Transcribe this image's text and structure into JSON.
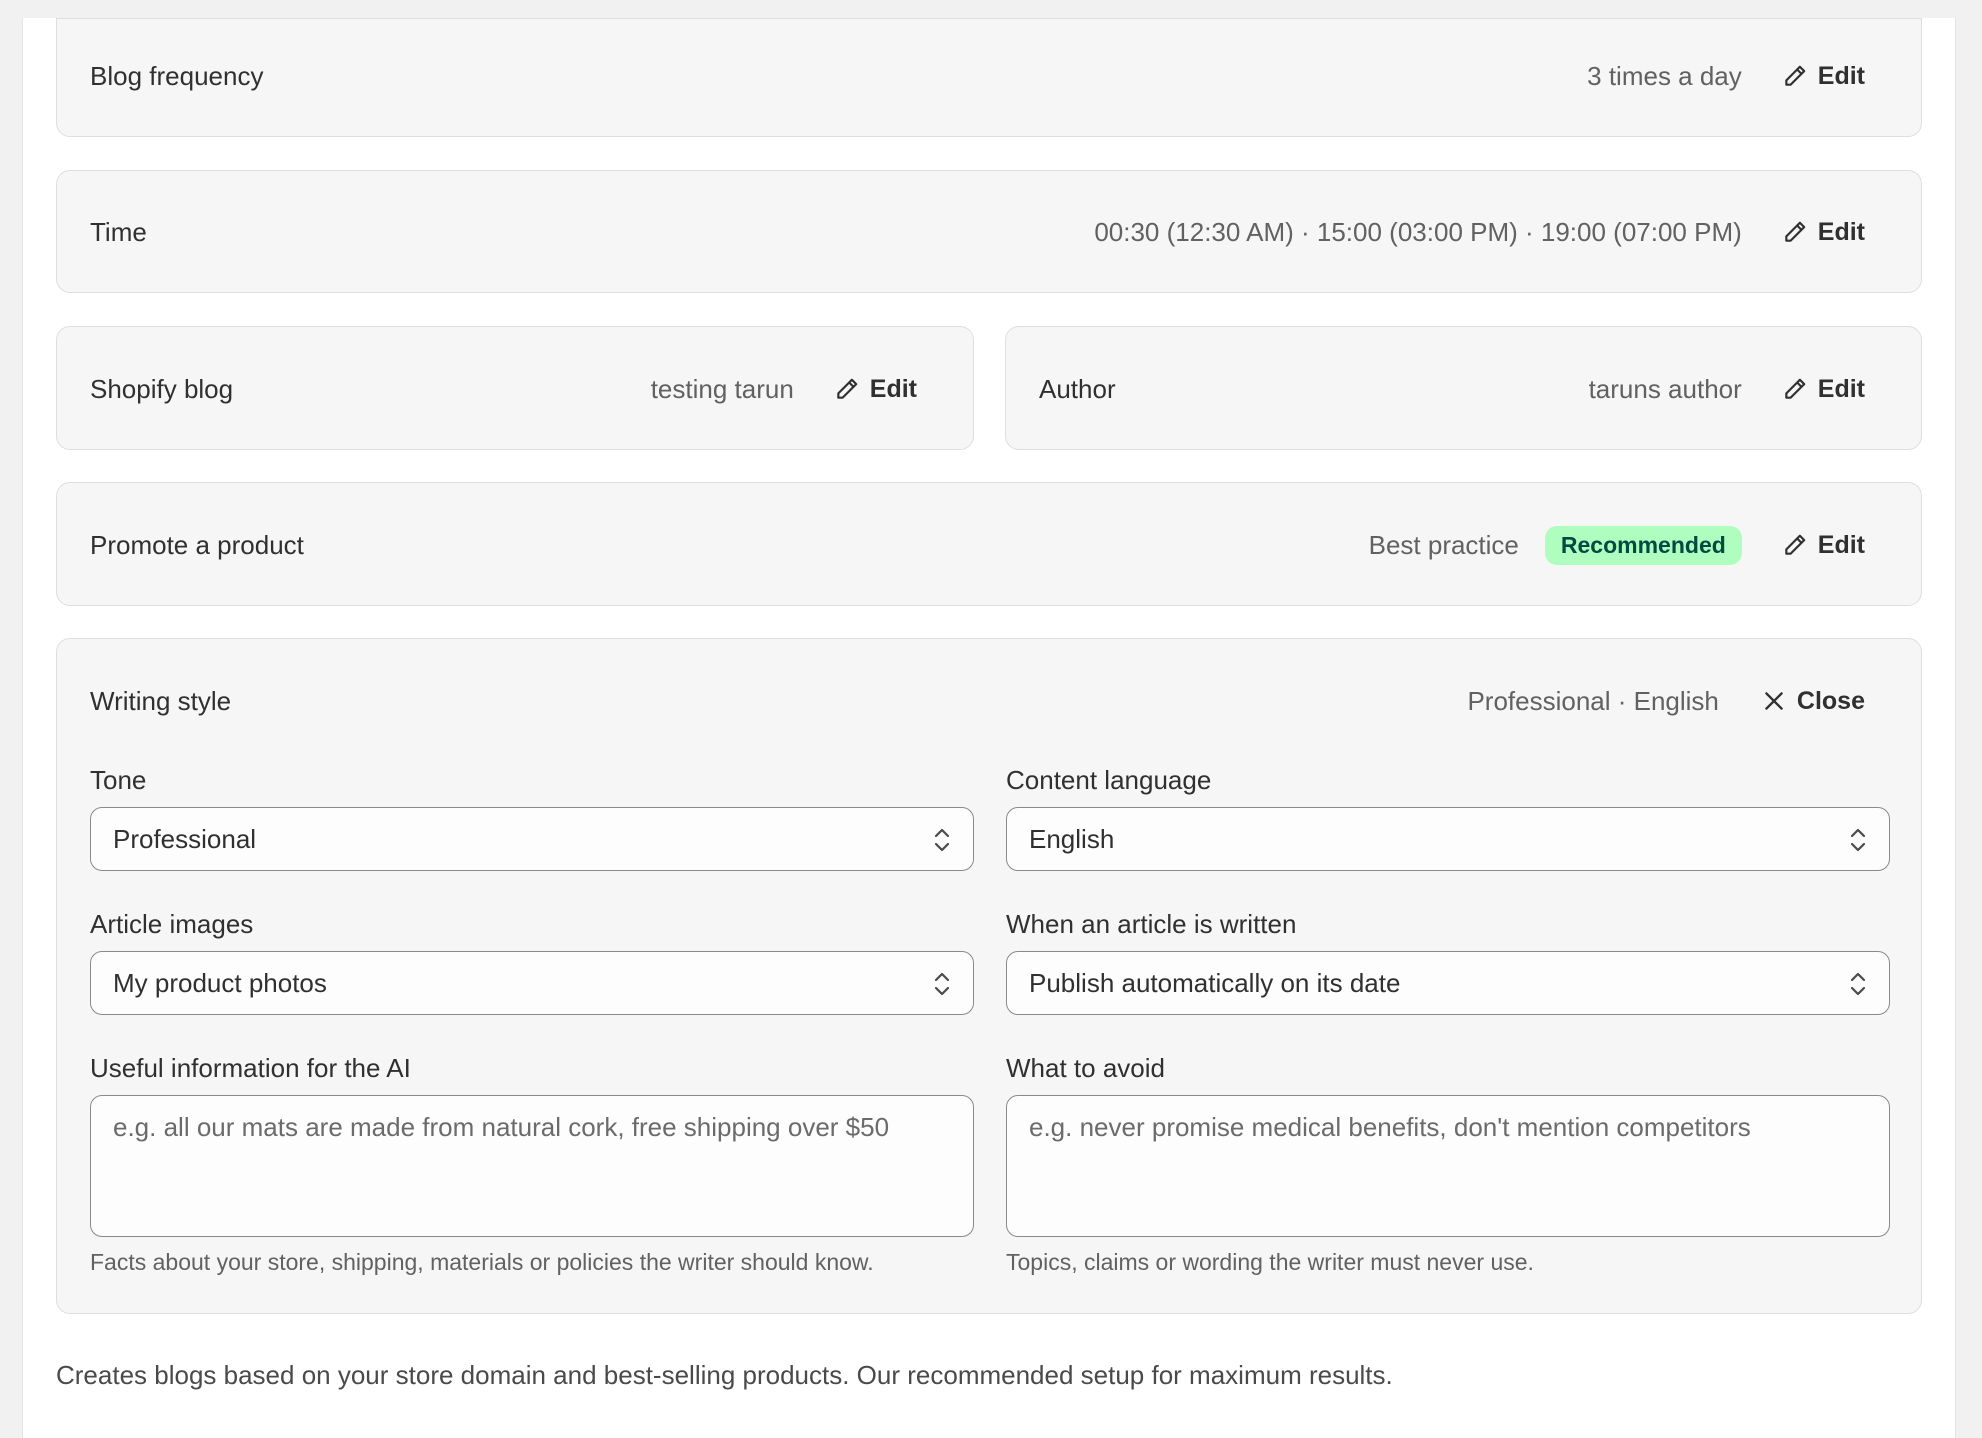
{
  "rows": {
    "blog_frequency": {
      "label": "Blog frequency",
      "value": "3 times a day",
      "action": "Edit"
    },
    "time": {
      "label": "Time",
      "value": "00:30 (12:30 AM) · 15:00 (03:00 PM) · 19:00 (07:00 PM)",
      "action": "Edit"
    },
    "shopify_blog": {
      "label": "Shopify blog",
      "value": "testing tarun",
      "action": "Edit"
    },
    "author": {
      "label": "Author",
      "value": "taruns author",
      "action": "Edit"
    },
    "promote": {
      "label": "Promote a product",
      "value": "Best practice",
      "badge": "Recommended",
      "action": "Edit"
    }
  },
  "writing_style": {
    "label": "Writing style",
    "summary": "Professional · English",
    "close": "Close",
    "tone": {
      "label": "Tone",
      "value": "Professional"
    },
    "language": {
      "label": "Content language",
      "value": "English"
    },
    "images": {
      "label": "Article images",
      "value": "My product photos"
    },
    "publish": {
      "label": "When an article is written",
      "value": "Publish automatically on its date"
    },
    "useful_info": {
      "label": "Useful information for the AI",
      "placeholder": "e.g. all our mats are made from natural cork, free shipping over $50",
      "help": "Facts about your store, shipping, materials or policies the writer should know."
    },
    "avoid": {
      "label": "What to avoid",
      "placeholder": "e.g. never promise medical benefits, don't mention competitors",
      "help": "Topics, claims or wording the writer must never use."
    }
  },
  "footer_note": "Creates blogs based on your store domain and best-selling products. Our recommended setup for maximum results.",
  "colors": {
    "badge_bg": "#affebf",
    "badge_text": "#014b40",
    "card_bg": "#f6f6f6"
  }
}
